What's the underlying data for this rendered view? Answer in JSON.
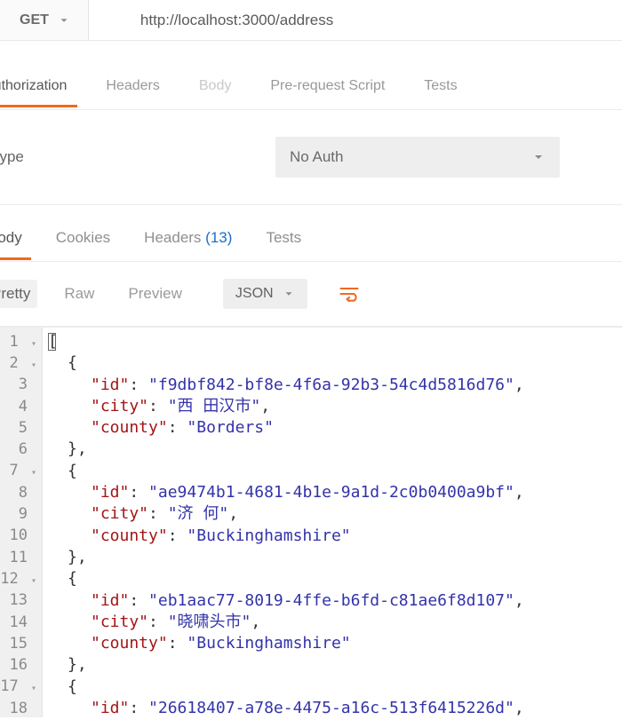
{
  "request": {
    "method": "GET",
    "url": "http://localhost:3000/address"
  },
  "request_tabs": {
    "items": [
      {
        "label": "Authorization",
        "active": true,
        "disabled": false
      },
      {
        "label": "Headers",
        "active": false,
        "disabled": false
      },
      {
        "label": "Body",
        "active": false,
        "disabled": true
      },
      {
        "label": "Pre-request Script",
        "active": false,
        "disabled": false
      },
      {
        "label": "Tests",
        "active": false,
        "disabled": false
      }
    ]
  },
  "auth": {
    "label": "Type",
    "selected": "No Auth"
  },
  "response_tabs": {
    "items": [
      {
        "label": "Body",
        "active": true,
        "count": null
      },
      {
        "label": "Cookies",
        "active": false,
        "count": null
      },
      {
        "label": "Headers",
        "active": false,
        "count": "13"
      },
      {
        "label": "Tests",
        "active": false,
        "count": null
      }
    ]
  },
  "viewer": {
    "modes": [
      {
        "label": "Pretty",
        "active": true
      },
      {
        "label": "Raw",
        "active": false
      },
      {
        "label": "Preview",
        "active": false
      }
    ],
    "format": "JSON"
  },
  "code": {
    "lines": [
      {
        "n": "1",
        "fold": true
      },
      {
        "n": "2",
        "fold": true
      },
      {
        "n": "3",
        "fold": false
      },
      {
        "n": "4",
        "fold": false
      },
      {
        "n": "5",
        "fold": false
      },
      {
        "n": "6",
        "fold": false
      },
      {
        "n": "7",
        "fold": true
      },
      {
        "n": "8",
        "fold": false
      },
      {
        "n": "9",
        "fold": false
      },
      {
        "n": "10",
        "fold": false
      },
      {
        "n": "11",
        "fold": false
      },
      {
        "n": "12",
        "fold": true
      },
      {
        "n": "13",
        "fold": false
      },
      {
        "n": "14",
        "fold": false
      },
      {
        "n": "15",
        "fold": false
      },
      {
        "n": "16",
        "fold": false
      },
      {
        "n": "17",
        "fold": true
      },
      {
        "n": "18",
        "fold": false
      }
    ],
    "data": [
      {
        "id": "f9dbf842-bf8e-4f6a-92b3-54c4d5816d76",
        "city": "西 田汉市",
        "county": "Borders"
      },
      {
        "id": "ae9474b1-4681-4b1e-9a1d-2c0b0400a9bf",
        "city": "济 何",
        "county": "Buckinghamshire"
      },
      {
        "id": "eb1aac77-8019-4ffe-b6fd-c81ae6f8d107",
        "city": "晓啸头市",
        "county": "Buckinghamshire"
      },
      {
        "id": "26618407-a78e-4475-a16c-513f6415226d"
      }
    ],
    "keys": {
      "id": "id",
      "city": "city",
      "county": "county"
    }
  }
}
